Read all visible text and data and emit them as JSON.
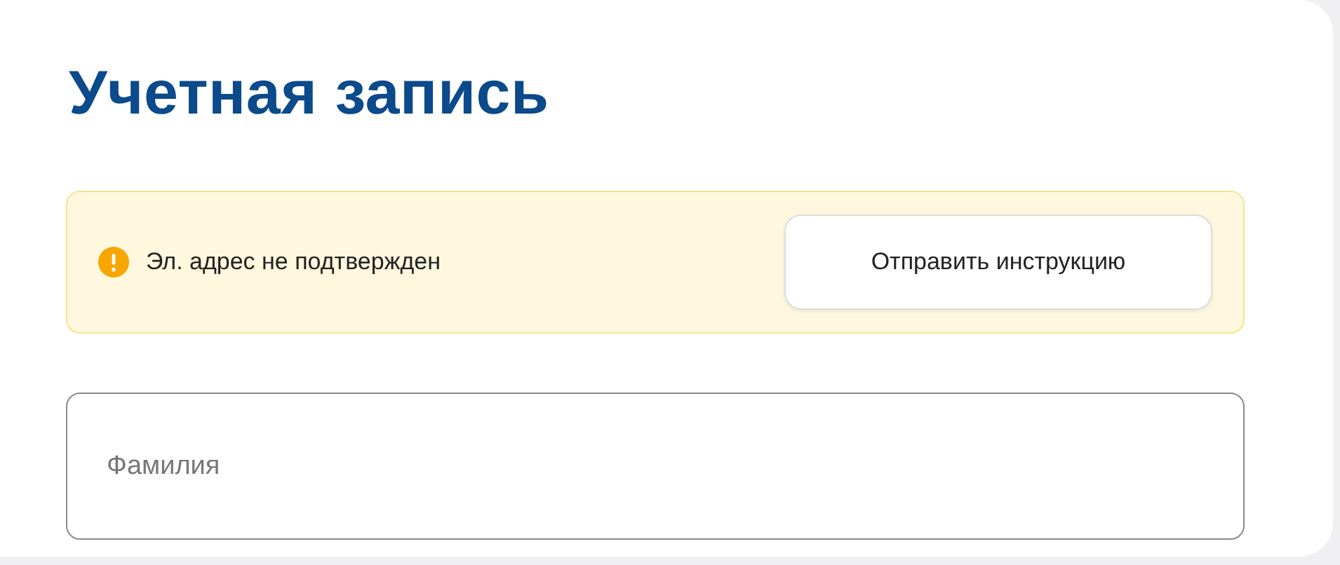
{
  "title": "Учетная запись",
  "alert": {
    "message": "Эл. адрес не подтвержден",
    "button": "Отправить инструкцию"
  },
  "fields": [
    {
      "placeholder": "Фамилия"
    }
  ]
}
